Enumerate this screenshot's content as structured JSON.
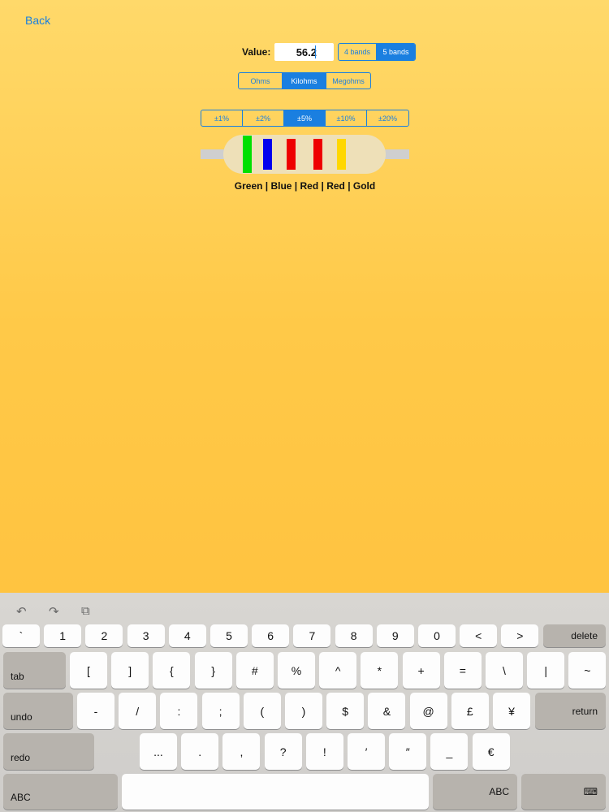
{
  "header": {
    "back_label": "Back"
  },
  "value": {
    "label": "Value:",
    "input": "56.2"
  },
  "bands": {
    "options": [
      "4 bands",
      "5 bands"
    ],
    "selected": 1
  },
  "units": {
    "options": [
      "Ohms",
      "Kilohms",
      "Megohms"
    ],
    "selected": 1
  },
  "tolerance": {
    "options": [
      "±1%",
      "±2%",
      "±5%",
      "±10%",
      "±20%"
    ],
    "selected": 2
  },
  "resistor": {
    "bands": [
      {
        "name": "Green",
        "color": "#00e000"
      },
      {
        "name": "Blue",
        "color": "#0000ee"
      },
      {
        "name": "Red",
        "color": "#ee0000"
      },
      {
        "name": "Red",
        "color": "#ee0000"
      },
      {
        "name": "Gold",
        "color": "#ffd700"
      }
    ],
    "body_color": "#eee0b8",
    "lead_color": "#cfcfcf",
    "color_text": "Green | Blue | Red | Red | Gold"
  },
  "keyboard": {
    "toolbar": [
      "undo-icon",
      "redo-icon",
      "paste-icon"
    ],
    "row1": [
      "`",
      "1",
      "2",
      "3",
      "4",
      "5",
      "6",
      "7",
      "8",
      "9",
      "0",
      "<",
      ">"
    ],
    "row1_delete": "delete",
    "row2_tab": "tab",
    "row2": [
      "[",
      "]",
      "{",
      "}",
      "#",
      "%",
      "^",
      "*",
      "+",
      "=",
      "\\",
      "|",
      "~"
    ],
    "row3_undo": "undo",
    "row3": [
      "-",
      "/",
      ":",
      ";",
      "(",
      ")",
      "$",
      "&",
      "@",
      "£",
      "¥"
    ],
    "row3_return": "return",
    "row4_redo": "redo",
    "row4": [
      "...",
      ".",
      ",",
      "?",
      "!",
      "′",
      "″",
      "_",
      "€"
    ],
    "row5_abc_left": "ABC",
    "row5_abc_right": "ABC"
  }
}
